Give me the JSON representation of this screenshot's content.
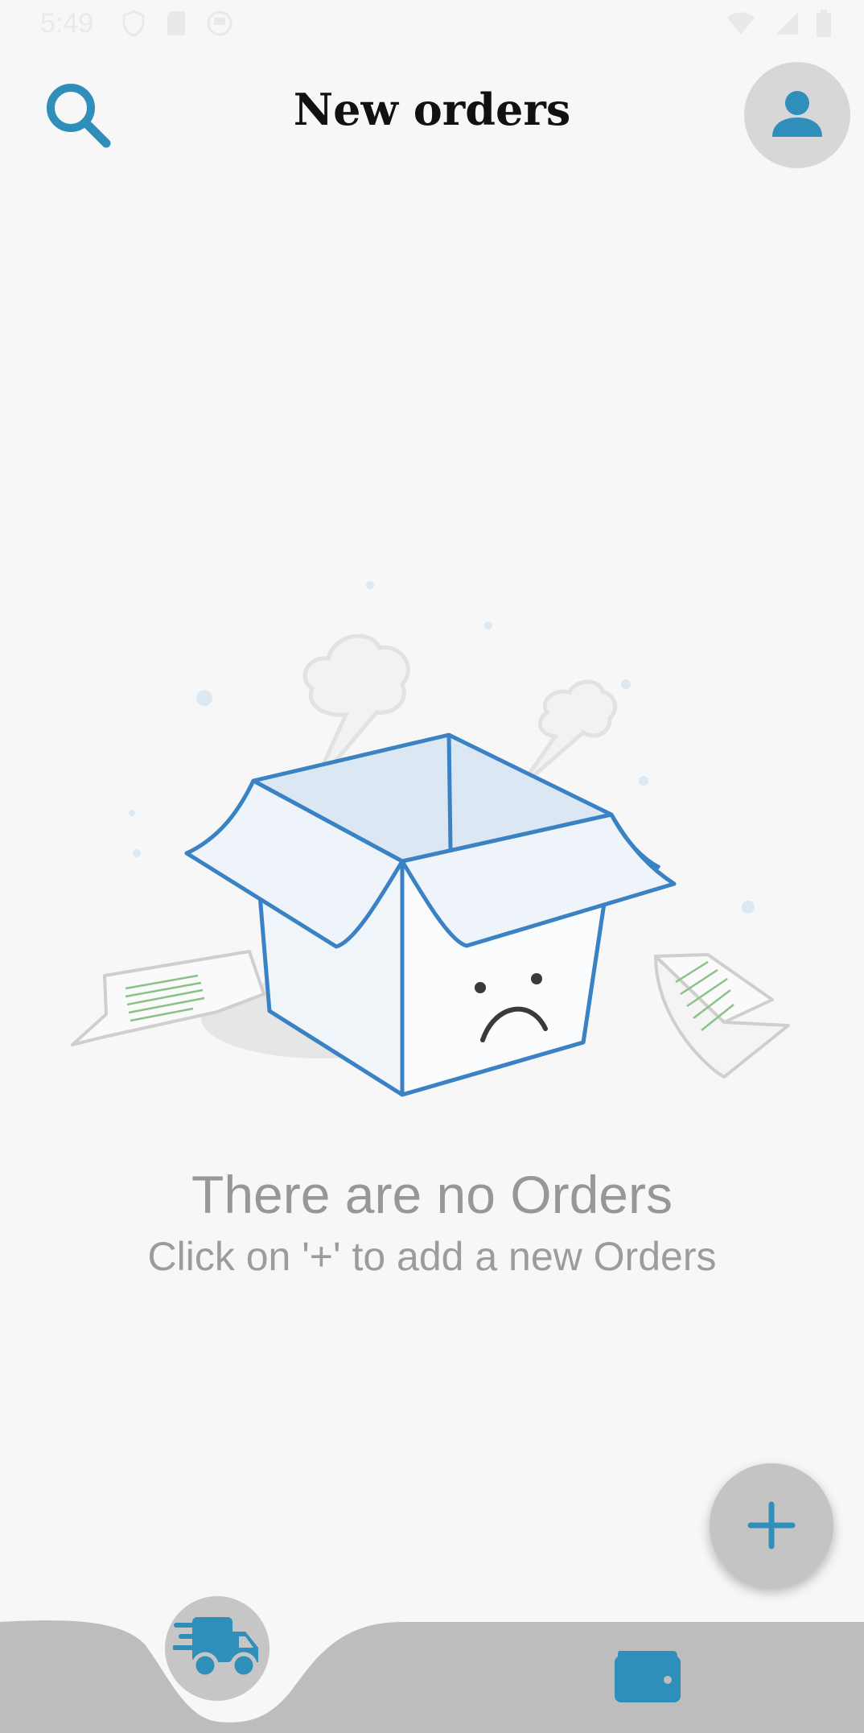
{
  "status_bar": {
    "time": "5:49"
  },
  "header": {
    "title": "New orders",
    "search_icon": "search-icon",
    "profile_icon": "person-icon"
  },
  "empty_state": {
    "title": "There are no Orders",
    "subtitle": "Click on '+' to add a new Orders",
    "illustration": "sad-empty-box"
  },
  "fab": {
    "icon": "plus-icon"
  },
  "bottom_nav": {
    "items": [
      {
        "icon": "delivery-truck-icon",
        "selected": true
      },
      {
        "icon": "wallet-icon",
        "selected": false
      }
    ]
  },
  "colors": {
    "accent": "#2f8fba",
    "background": "#f7f7f7",
    "nav_bar": "#bdbdbd",
    "fab": "#c4c4c4",
    "empty_text": "#979797"
  }
}
